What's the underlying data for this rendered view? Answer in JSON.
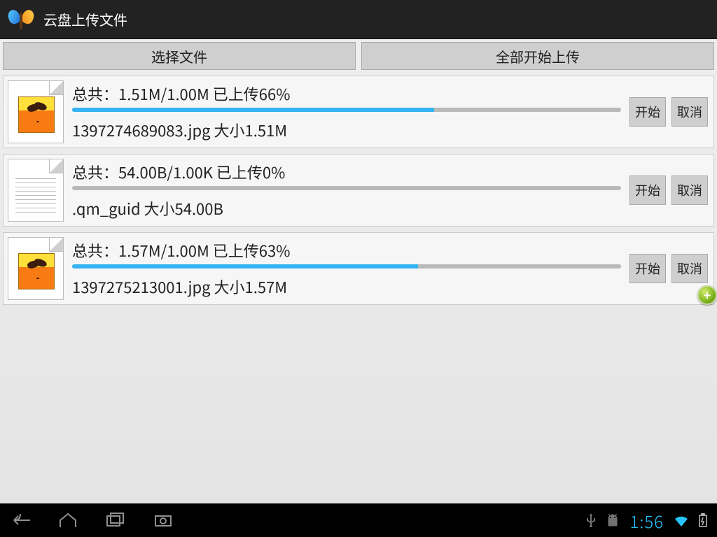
{
  "header": {
    "title": "云盘上传文件"
  },
  "toolbar": {
    "select_files_label": "选择文件",
    "start_all_label": "全部开始上传"
  },
  "item_button_labels": {
    "start": "开始",
    "cancel": "取消"
  },
  "uploads": [
    {
      "icon_kind": "image",
      "total_line": "总共：1.51M/1.00M  已上传66%",
      "file_line": "1397274689083.jpg   大小1.51M",
      "progress_pct": 66
    },
    {
      "icon_kind": "text",
      "total_line": "总共：54.00B/1.00K  已上传0%",
      "file_line": ".qm_guid   大小54.00B",
      "progress_pct": 0
    },
    {
      "icon_kind": "image",
      "total_line": "总共：1.57M/1.00M  已上传63%",
      "file_line": "1397275213001.jpg   大小1.57M",
      "progress_pct": 63
    }
  ],
  "statusbar": {
    "clock": "1:56"
  }
}
